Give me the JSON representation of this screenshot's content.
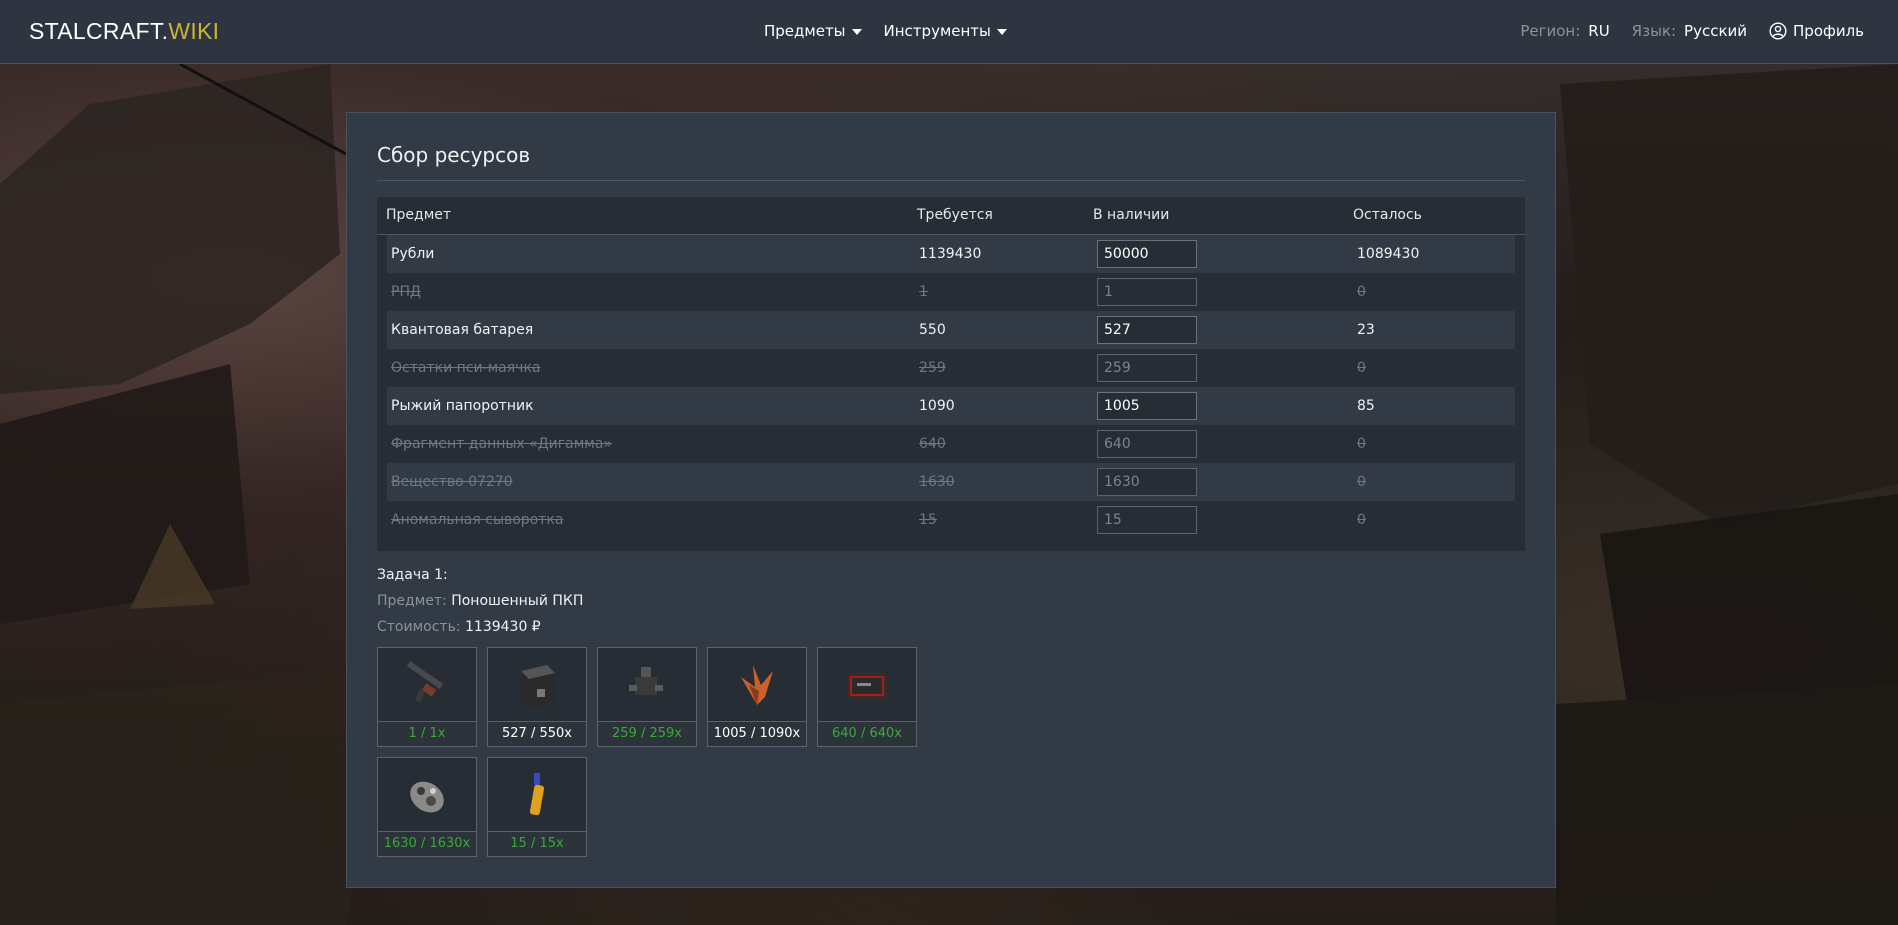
{
  "header": {
    "logo_main": "STALCRAFT.",
    "logo_accent": "WIKI",
    "nav": [
      {
        "label": "Предметы"
      },
      {
        "label": "Инструменты"
      }
    ],
    "region_label": "Регион:",
    "region_value": "RU",
    "language_label": "Язык:",
    "language_value": "Русский",
    "profile_label": "Профиль"
  },
  "panel": {
    "title": "Сбор ресурсов",
    "columns": {
      "item": "Предмет",
      "required": "Требуется",
      "available": "В наличии",
      "remaining": "Осталось"
    },
    "rows": [
      {
        "name": "Рубли",
        "required": "1139430",
        "available": "50000",
        "remaining": "1089430",
        "done": false
      },
      {
        "name": "РПД",
        "required": "1",
        "available": "1",
        "remaining": "0",
        "done": true
      },
      {
        "name": "Квантовая батарея",
        "required": "550",
        "available": "527",
        "remaining": "23",
        "done": false
      },
      {
        "name": "Остатки пси-маячка",
        "required": "259",
        "available": "259",
        "remaining": "0",
        "done": true
      },
      {
        "name": "Рыжий папоротник",
        "required": "1090",
        "available": "1005",
        "remaining": "85",
        "done": false
      },
      {
        "name": "Фрагмент данных «Дигамма»",
        "required": "640",
        "available": "640",
        "remaining": "0",
        "done": true
      },
      {
        "name": "Вещество 07270",
        "required": "1630",
        "available": "1630",
        "remaining": "0",
        "done": true
      },
      {
        "name": "Аномальная сыворотка",
        "required": "15",
        "available": "15",
        "remaining": "0",
        "done": true
      }
    ],
    "task": {
      "heading": "Задача 1:",
      "item_label": "Предмет:",
      "item_value": "Поношенный ПКП",
      "cost_label": "Стоимость:",
      "cost_value": "1139430 ₽"
    },
    "tiles": [
      {
        "icon": "machine-gun-icon",
        "count": "1 / 1x",
        "complete": true
      },
      {
        "icon": "battery-icon",
        "count": "527 / 550x",
        "complete": false
      },
      {
        "icon": "psi-beacon-icon",
        "count": "259 / 259x",
        "complete": true
      },
      {
        "icon": "fern-icon",
        "count": "1005 / 1090x",
        "complete": false
      },
      {
        "icon": "data-fragment-icon",
        "count": "640 / 640x",
        "complete": true
      },
      {
        "icon": "substance-icon",
        "count": "1630 / 1630x",
        "complete": true
      },
      {
        "icon": "serum-icon",
        "count": "15 / 15x",
        "complete": true
      }
    ],
    "colors": {
      "complete": "#3aa83a",
      "accent": "#c9b530"
    }
  }
}
